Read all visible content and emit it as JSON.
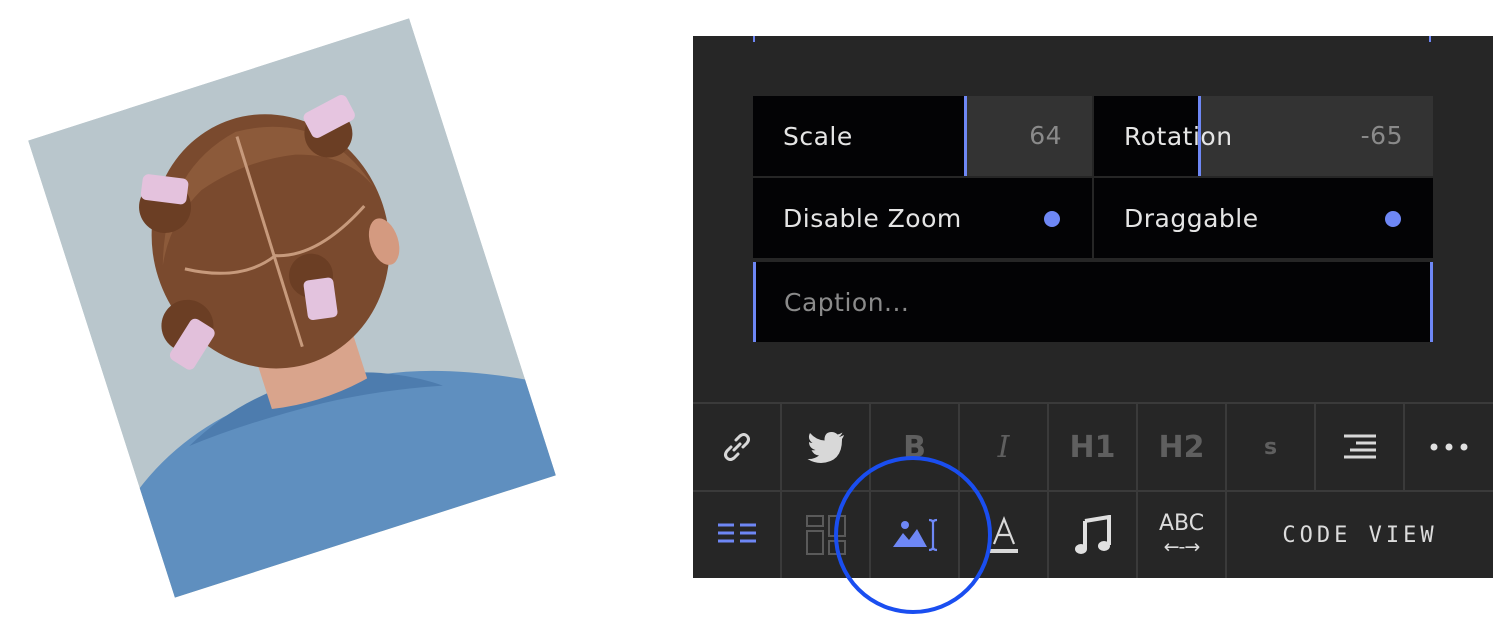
{
  "image": {
    "alt": "Photo of a child's head from behind with pink hair clips",
    "rotation_deg": -17.8
  },
  "controls": {
    "scale": {
      "label": "Scale",
      "value": "64",
      "level_fraction": 0.64
    },
    "rotation": {
      "label": "Rotation",
      "value": "-65",
      "level_fraction": 0.32
    },
    "disable_zoom": {
      "label": "Disable Zoom",
      "on": true
    },
    "draggable": {
      "label": "Draggable",
      "on": true
    },
    "caption": {
      "placeholder": "Caption...",
      "value": ""
    }
  },
  "toolbar": {
    "row1": [
      {
        "name": "link-button",
        "icon": "link-icon"
      },
      {
        "name": "twitter-button",
        "icon": "twitter-icon"
      },
      {
        "name": "bold-button",
        "label": "B"
      },
      {
        "name": "italic-button",
        "label": "I"
      },
      {
        "name": "h1-button",
        "label": "H1"
      },
      {
        "name": "h2-button",
        "label": "H2"
      },
      {
        "name": "strikethrough-button",
        "label": "s"
      },
      {
        "name": "align-right-button",
        "icon": "align-right-icon"
      },
      {
        "name": "more-button",
        "icon": "more-icon"
      }
    ],
    "row2": {
      "abc_label": "ABC",
      "abc_arrow": "←-→",
      "code_view_label": "CODE VIEW"
    }
  },
  "colors": {
    "accent": "#6e87f5",
    "panel_bg": "#262626",
    "control_bg": "#030305",
    "focus_ring": "#1a4ef0"
  }
}
